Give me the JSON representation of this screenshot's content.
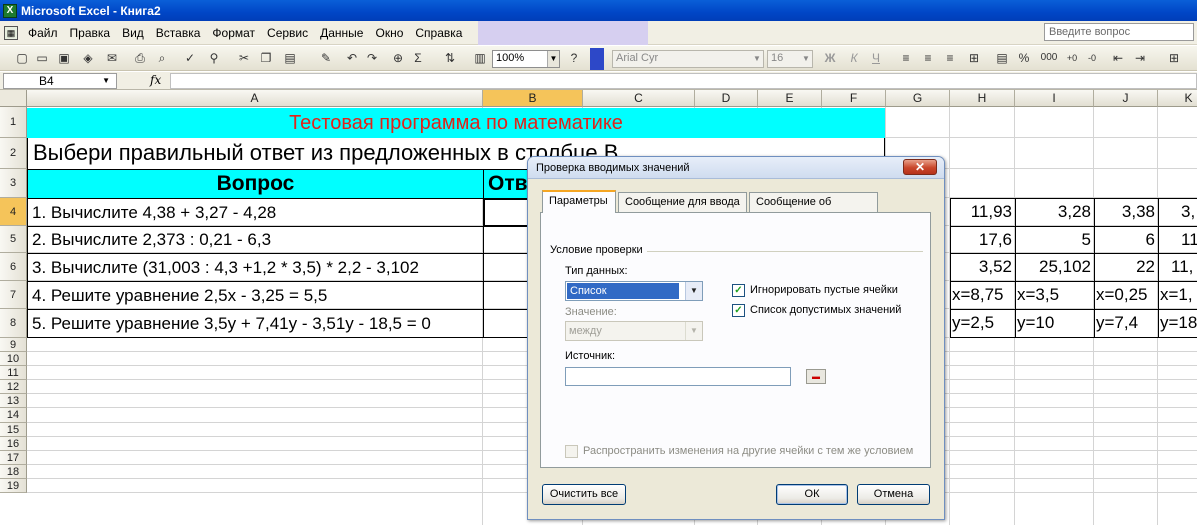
{
  "window": {
    "title": "Microsoft Excel - Книга2",
    "app_icon_glyph": "X"
  },
  "menu": {
    "items": [
      "Файл",
      "Правка",
      "Вид",
      "Вставка",
      "Формат",
      "Сервис",
      "Данные",
      "Окно",
      "Справка"
    ],
    "help_placeholder": "Введите вопрос"
  },
  "toolbar": {
    "zoom": "100%",
    "font_name": "Arial Cyr",
    "font_size": "16",
    "bold": "Ж",
    "italic": "К",
    "underline": "Ч",
    "percent": "%",
    "thousands": "000"
  },
  "formula_bar": {
    "name_box": "B4",
    "fx": "fx",
    "formula": ""
  },
  "sheet": {
    "columns": [
      "A",
      "B",
      "C",
      "D",
      "E",
      "F",
      "G",
      "H",
      "I",
      "J",
      "K"
    ],
    "selected_column": "B",
    "rows": [
      "1",
      "2",
      "3",
      "4",
      "5",
      "6",
      "7",
      "8",
      "9",
      "10",
      "11",
      "12",
      "13",
      "14",
      "15",
      "16",
      "17",
      "18",
      "19"
    ],
    "selected_row": "4",
    "title": "Тестовая программа по математике",
    "subtitle": "Выбери правильный ответ из предложенных в столбце В",
    "header_question": "Вопрос",
    "header_answer": "Ответ",
    "questions": [
      "1. Вычислите 4,38 + 3,27 - 4,28",
      "2. Вычислите 2,373 : 0,21 - 6,3",
      "3. Вычислите (31,003 : 4,3 +1,2 * 3,5) * 2,2 - 3,102",
      "4. Решите уравнение 2,5х - 3,25 = 5,5",
      "5. Решите уравнение 3,5у + 7,41у - 3,51у - 18,5 = 0"
    ],
    "options": {
      "H": [
        "11,93",
        "17,6",
        "3,52",
        "x=8,75",
        "y=2,5"
      ],
      "I": [
        "3,28",
        "5",
        "25,102",
        "x=3,5",
        "y=10"
      ],
      "J": [
        "3,38",
        "6",
        "22",
        "x=0,25",
        "y=7,4"
      ],
      "K": [
        "3,",
        "11",
        "11,",
        "x=1,",
        "y=18"
      ]
    }
  },
  "dialog": {
    "title": "Проверка вводимых значений",
    "close_glyph": "✕",
    "tabs": [
      "Параметры",
      "Сообщение для ввода",
      "Сообщение об ошибке"
    ],
    "active_tab": "Параметры",
    "group_label": "Условие проверки",
    "data_type_label": "Тип данных:",
    "data_type_value": "Список",
    "value_label": "Значение:",
    "value_value": "между",
    "ignore_blank_label": "Игнорировать пустые ячейки",
    "ignore_blank_checked": true,
    "in_cell_dropdown_label": "Список допустимых значений",
    "in_cell_dropdown_checked": true,
    "source_label": "Источник:",
    "source_value": "",
    "apply_all_label": "Распространить изменения на другие ячейки с тем же условием",
    "apply_all_checked": false,
    "clear_all_button": "Очистить все",
    "ok_button": "ОК",
    "cancel_button": "Отмена"
  },
  "colors": {
    "cyan_fill": "#00ffff",
    "title_red": "#e0241a",
    "selected_header": "#f5c45a",
    "xp_title_blue": "#0046c6"
  }
}
